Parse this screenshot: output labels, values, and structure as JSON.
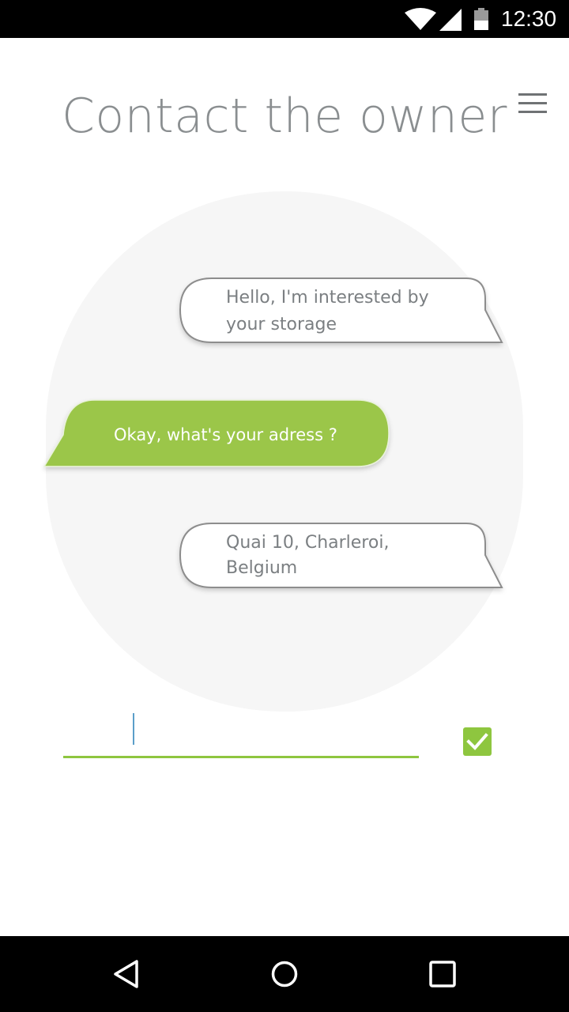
{
  "status_bar": {
    "time": "12:30",
    "icons": [
      "wifi-icon",
      "signal-icon",
      "battery-icon"
    ]
  },
  "header": {
    "title": "Contact the owner",
    "menu_icon": "hamburger-menu-icon"
  },
  "messages": [
    {
      "sender": "user",
      "line1": "Hello, I'm interested by",
      "line2": "your storage"
    },
    {
      "sender": "owner",
      "line1": "Okay, what's your adress ?"
    },
    {
      "sender": "user",
      "line1": "Quai 10, Charleroi,",
      "line2": "Belgium"
    }
  ],
  "composer": {
    "input_value": "",
    "input_placeholder": "",
    "send_icon": "checkmark-icon"
  },
  "nav_bar": {
    "icons": [
      "back-icon",
      "home-icon",
      "recents-icon"
    ]
  },
  "colors": {
    "accent": "#8ec63f",
    "outgoing_bubble": "#9bc64a",
    "title_text": "#8a8e90",
    "bubble_text": "#7b7f82",
    "chat_background": "#f6f6f6"
  }
}
